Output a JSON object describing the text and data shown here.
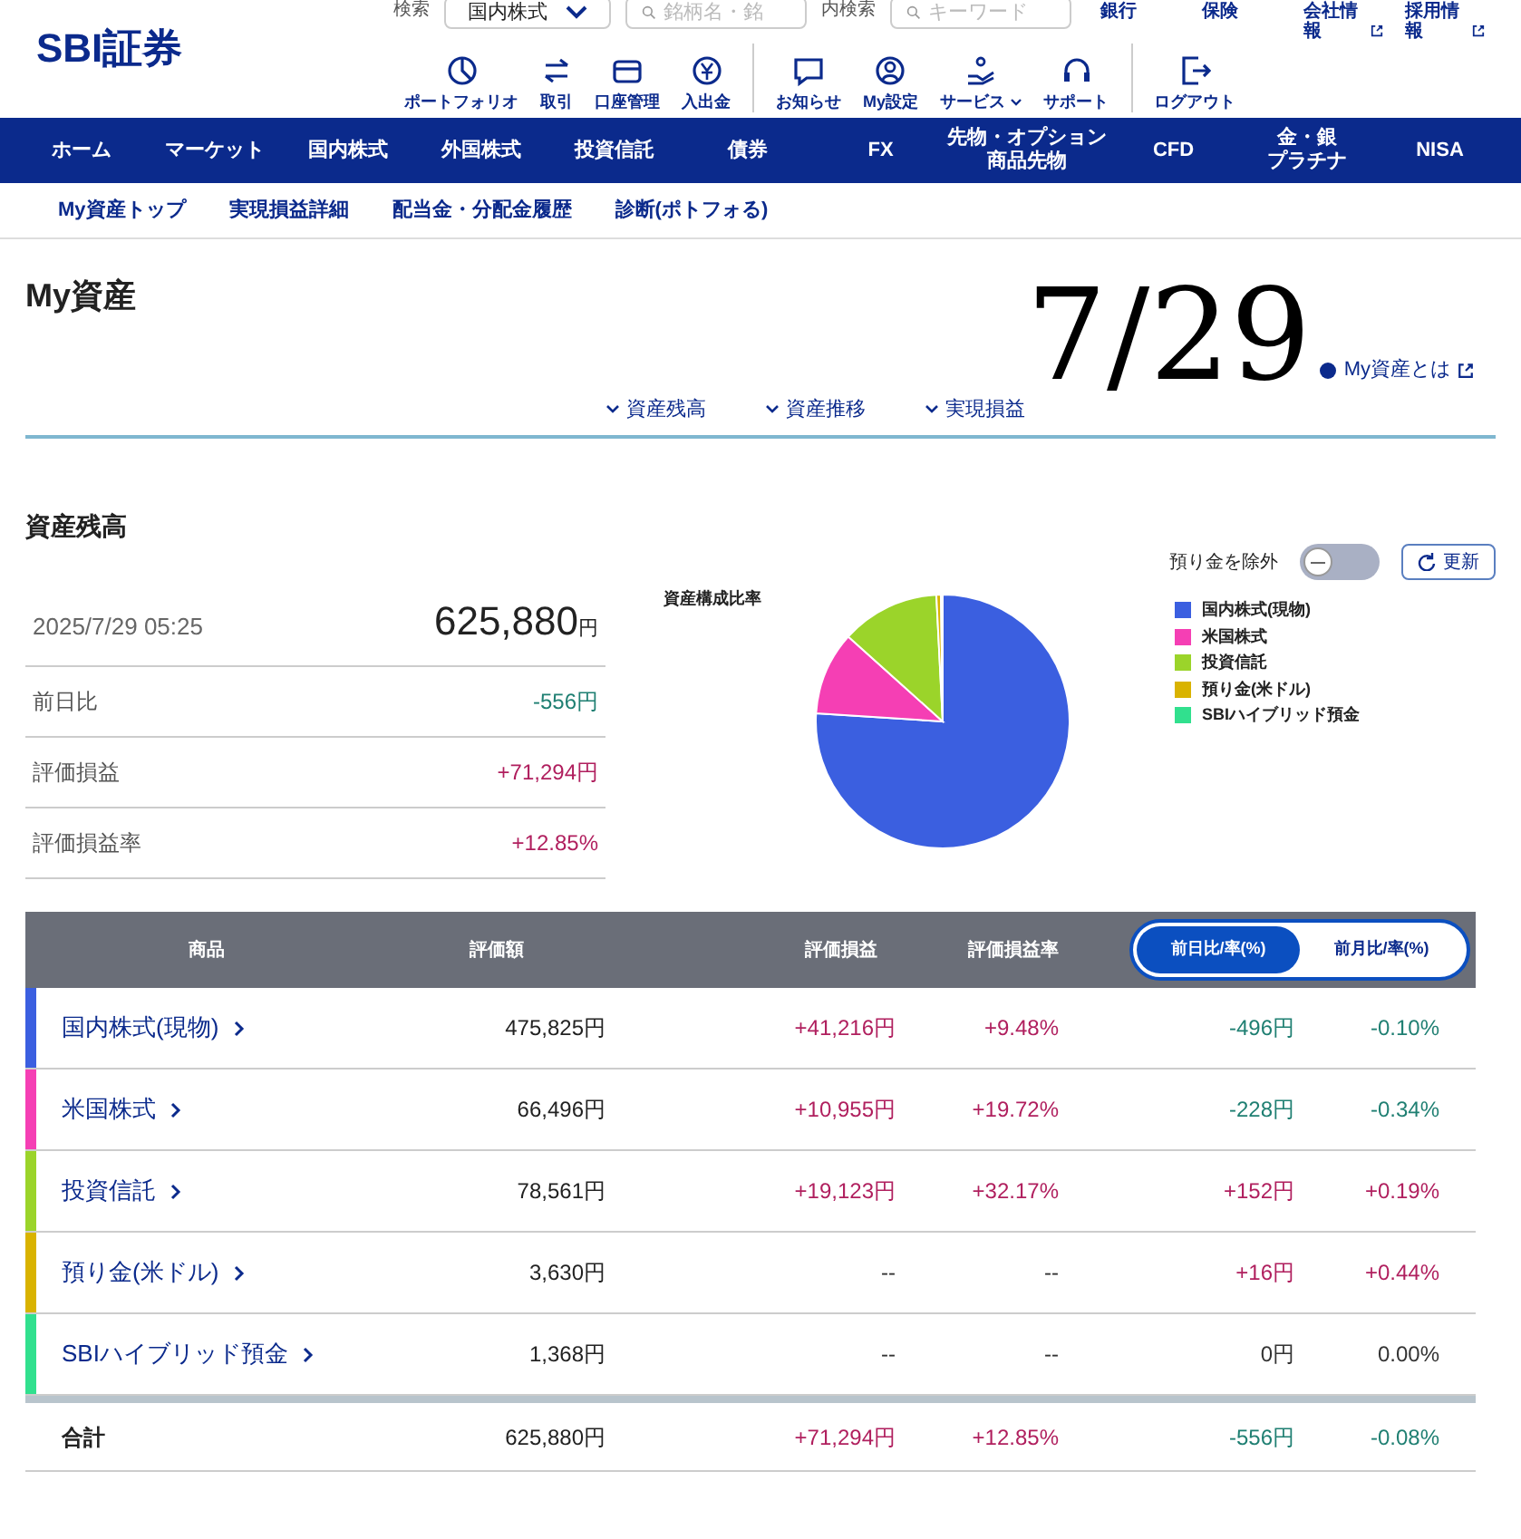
{
  "header": {
    "logo": "SBI証券",
    "stock_search": {
      "label": "検索",
      "select": "国内株式",
      "placeholder": "銘柄名・銘"
    },
    "site_search": {
      "label": "内検索",
      "placeholder": "キーワード"
    },
    "links": [
      {
        "label": "銀行",
        "external": false
      },
      {
        "label": "保険",
        "external": false
      },
      {
        "label": "会社情報",
        "external": true
      },
      {
        "label": "採用情報",
        "external": true
      }
    ],
    "icon_groups": [
      [
        {
          "label": "ポートフォリオ",
          "kind": "pie"
        },
        {
          "label": "取引",
          "kind": "swap"
        },
        {
          "label": "口座管理",
          "kind": "card"
        },
        {
          "label": "入出金",
          "kind": "yen"
        }
      ],
      [
        {
          "label": "お知らせ",
          "kind": "chat"
        },
        {
          "label": "My設定",
          "kind": "user"
        },
        {
          "label": "サービス",
          "kind": "hand",
          "caret": true
        },
        {
          "label": "サポート",
          "kind": "headset"
        }
      ],
      [
        {
          "label": "ログアウト",
          "kind": "logout"
        }
      ]
    ]
  },
  "nav": [
    {
      "lines": [
        "ホーム"
      ]
    },
    {
      "lines": [
        "マーケット"
      ]
    },
    {
      "lines": [
        "国内株式"
      ]
    },
    {
      "lines": [
        "外国株式"
      ]
    },
    {
      "lines": [
        "投資信託"
      ]
    },
    {
      "lines": [
        "債券"
      ]
    },
    {
      "lines": [
        "FX"
      ]
    },
    {
      "lines": [
        "先物・オプション",
        "商品先物"
      ]
    },
    {
      "lines": [
        "CFD"
      ]
    },
    {
      "lines": [
        "金・銀",
        "プラチナ"
      ]
    },
    {
      "lines": [
        "NISA"
      ]
    }
  ],
  "subnav": [
    "My資産トップ",
    "実現損益詳細",
    "配当金・分配金履歴",
    "診断(ポトフォる)"
  ],
  "page_title": "My資産",
  "help_link": "My資産とは",
  "annotation": "7/29",
  "anchors": [
    "資産残高",
    "資産推移",
    "実現損益"
  ],
  "section_title": "資産残高",
  "exclude_toggle": {
    "label": "預り金を除外",
    "on": false
  },
  "refresh_button": "更新",
  "summary": {
    "datetime": "2025/7/29 05:25",
    "total": "625,880",
    "unit": "円",
    "rows": [
      {
        "label": "前日比",
        "value": "-556円",
        "color": "#1f7f72"
      },
      {
        "label": "評価損益",
        "value": "+71,294円",
        "color": "#b01f5e"
      },
      {
        "label": "評価損益率",
        "value": "+12.85%",
        "color": "#b01f5e"
      }
    ]
  },
  "pie": {
    "title": "資産構成比率",
    "legend": [
      {
        "label": "国内株式(現物)",
        "color": "#3b5fe0"
      },
      {
        "label": "米国株式",
        "color": "#f53fb4"
      },
      {
        "label": "投資信託",
        "color": "#9bd42a"
      },
      {
        "label": "預り金(米ドル)",
        "color": "#d9b300"
      },
      {
        "label": "SBIハイブリッド預金",
        "color": "#31e08e"
      }
    ]
  },
  "table": {
    "columns": [
      "商品",
      "評価額",
      "評価損益",
      "評価損益率"
    ],
    "compare_tabs": [
      {
        "label": "前日比/率(%)",
        "selected": true
      },
      {
        "label": "前月比/率(%)",
        "selected": false
      }
    ],
    "rows": [
      {
        "name": "国内株式(現物)",
        "color": "#3b5fe0",
        "amount": "475,825円",
        "pl": {
          "text": "+41,216円",
          "color": "#b01f5e"
        },
        "rate": {
          "text": "+9.48%",
          "color": "#b01f5e"
        },
        "diff": {
          "text": "-496円",
          "color": "#1f7f72"
        },
        "diff_rate": {
          "text": "-0.10%",
          "color": "#1f7f72"
        }
      },
      {
        "name": "米国株式",
        "color": "#f53fb4",
        "amount": "66,496円",
        "pl": {
          "text": "+10,955円",
          "color": "#b01f5e"
        },
        "rate": {
          "text": "+19.72%",
          "color": "#b01f5e"
        },
        "diff": {
          "text": "-228円",
          "color": "#1f7f72"
        },
        "diff_rate": {
          "text": "-0.34%",
          "color": "#1f7f72"
        }
      },
      {
        "name": "投資信託",
        "color": "#9bd42a",
        "amount": "78,561円",
        "pl": {
          "text": "+19,123円",
          "color": "#b01f5e"
        },
        "rate": {
          "text": "+32.17%",
          "color": "#b01f5e"
        },
        "diff": {
          "text": "+152円",
          "color": "#b01f5e"
        },
        "diff_rate": {
          "text": "+0.19%",
          "color": "#b01f5e"
        }
      },
      {
        "name": "預り金(米ドル)",
        "color": "#d9b300",
        "amount": "3,630円",
        "pl": {
          "text": "--",
          "color": "#333333"
        },
        "rate": {
          "text": "--",
          "color": "#333333"
        },
        "diff": {
          "text": "+16円",
          "color": "#b01f5e"
        },
        "diff_rate": {
          "text": "+0.44%",
          "color": "#b01f5e"
        }
      },
      {
        "name": "SBIハイブリッド預金",
        "color": "#31e08e",
        "amount": "1,368円",
        "pl": {
          "text": "--",
          "color": "#333333"
        },
        "rate": {
          "text": "--",
          "color": "#333333"
        },
        "diff": {
          "text": "0円",
          "color": "#333333"
        },
        "diff_rate": {
          "text": "0.00%",
          "color": "#333333"
        }
      }
    ],
    "total": {
      "name": "合計",
      "amount": "625,880円",
      "pl": {
        "text": "+71,294円",
        "color": "#b01f5e"
      },
      "rate": {
        "text": "+12.85%",
        "color": "#b01f5e"
      },
      "diff": {
        "text": "-556円",
        "color": "#1f7f72"
      },
      "diff_rate": {
        "text": "-0.08%",
        "color": "#1f7f72"
      }
    }
  }
}
